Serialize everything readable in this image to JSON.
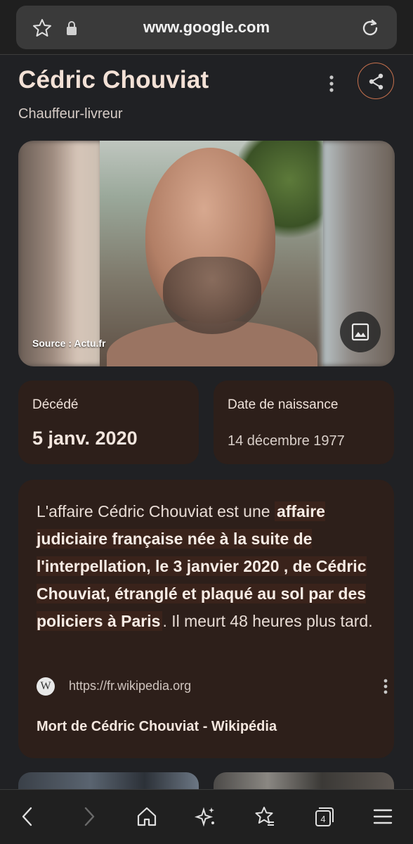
{
  "browser": {
    "url": "www.google.com",
    "icons": [
      "bookmark-star-icon",
      "lock-icon",
      "reload-icon"
    ]
  },
  "header": {
    "title": "Cédric Chouviat",
    "subtitle": "Chauffeur-livreur",
    "icons": [
      "more-vert-icon",
      "share-icon"
    ],
    "accent_color": "#c7714d"
  },
  "image": {
    "source": "Source : Actu.fr",
    "icon": "image-gallery-icon"
  },
  "facts": [
    {
      "label": "Décédé",
      "value": "5 janv. 2020"
    },
    {
      "label": "Date de naissance",
      "value": "14 décembre 1977"
    }
  ],
  "description": {
    "part1": "L'affaire Cédric Chouviat est une ",
    "highlight": "affaire judiciaire française née à la suite de l'interpellation, le 3 janvier 2020 , de Cédric Chouviat, étranglé et plaqué au sol par des policiers à Paris",
    "part2": ". Il meurt 48 heures plus tard.",
    "source_logo": "W",
    "source_url": "https://fr.wikipedia.org",
    "link_title": "Mort de Cédric Chouviat - Wikipédia"
  },
  "colors": {
    "background": "#202124",
    "card": "#2d1f1a",
    "highlight": "#3a231b"
  },
  "bottom_nav": {
    "tab_count": "4",
    "icons": [
      "back-icon",
      "forward-icon",
      "home-icon",
      "sparkle-icon",
      "bookmarks-icon",
      "tabs-icon",
      "menu-icon"
    ]
  }
}
